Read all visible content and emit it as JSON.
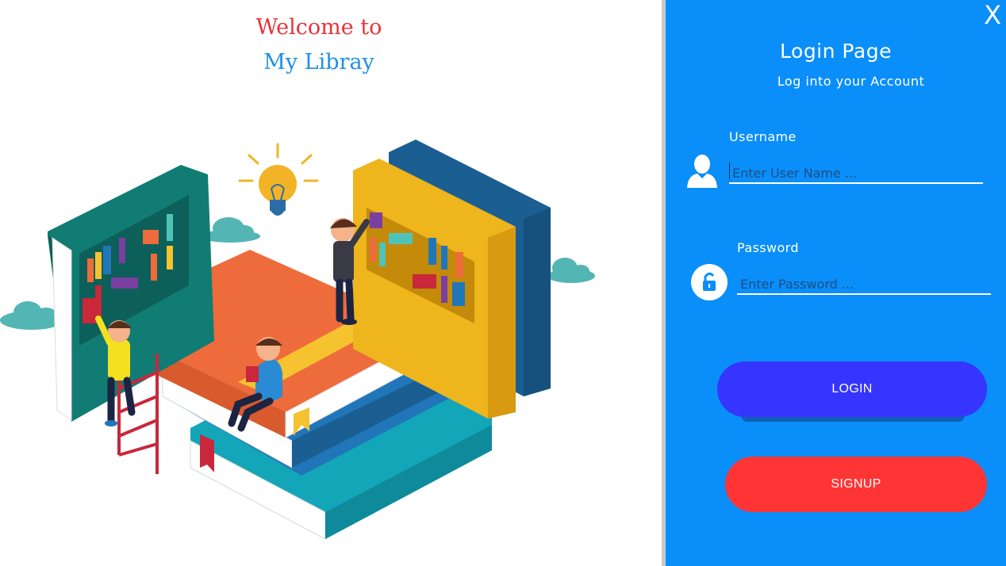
{
  "welcome": {
    "line1": "Welcome to",
    "line2": "My Libray"
  },
  "panel": {
    "close_label": "X",
    "title": "Login Page",
    "subtitle": "Log into your Account",
    "username": {
      "label": "Username",
      "placeholder": "Enter User Name ...",
      "value": ""
    },
    "password": {
      "label": "Password",
      "placeholder": "Enter Password ...",
      "value": ""
    },
    "login_label": "LOGIN",
    "signup_label": "SIGNUP"
  },
  "colors": {
    "panel_bg": "#0a8ef9",
    "login_button": "#3535ff",
    "signup_button": "#ff3535",
    "welcome_red": "#e8333a",
    "welcome_blue": "#1e8fe6"
  },
  "icons": {
    "username": "user-icon",
    "password": "lock-icon",
    "close": "close-icon"
  }
}
